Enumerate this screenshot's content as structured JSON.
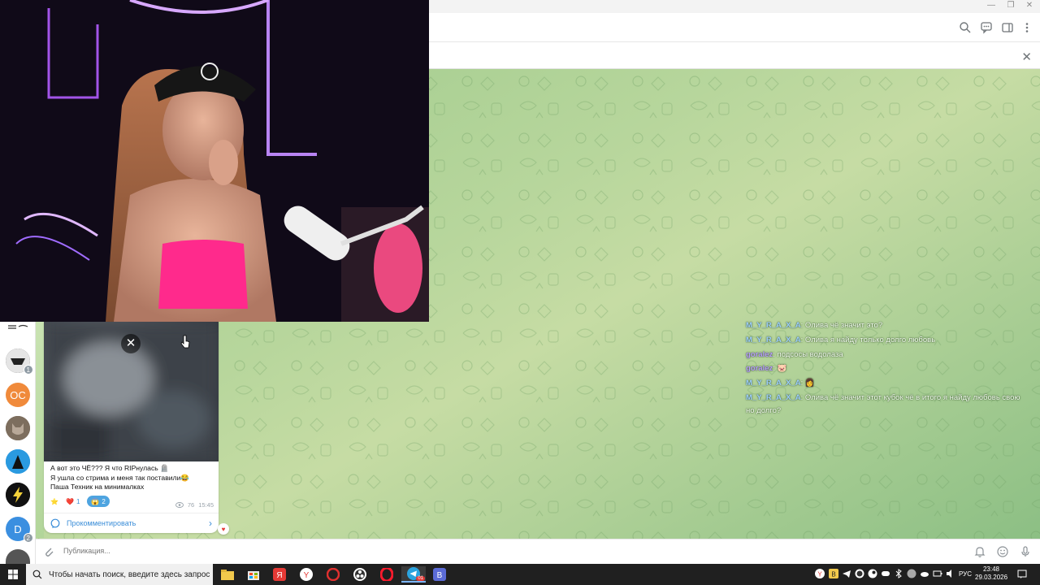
{
  "pinned": {
    "close_icon": "close-icon"
  },
  "overlay_chat": [
    {
      "user": "M_Y_R_A_X_A",
      "user_color": "#9fd0ff",
      "text": "Олива чё значит это?"
    },
    {
      "user": "M_Y_R_A_X_A",
      "user_color": "#9fd0ff",
      "text": "Олива я найду только долго любовь"
    },
    {
      "user": "goralez",
      "user_color": "#b99cff",
      "text": "подсосы водолаза"
    },
    {
      "user": "goralez",
      "user_color": "#b99cff",
      "text": "🐷"
    },
    {
      "user": "M_Y_R_A_X_A",
      "user_color": "#9fd0ff",
      "text": "👩"
    },
    {
      "user": "M_Y_R_A_X_A",
      "user_color": "#9fd0ff",
      "text": "Олива чё значит этот кубок чё в итого я найду любовь свою",
      "continuation": "но долго?"
    }
  ],
  "sidebar": {
    "items": [
      {
        "initials": "",
        "color": "#2b2b2b",
        "badge": "1"
      },
      {
        "initials": "OC",
        "color": "#f08a3b",
        "badge": ""
      },
      {
        "initials": "",
        "color": "#6a5a4a",
        "badge": ""
      },
      {
        "initials": "",
        "color": "#2f8fd8",
        "badge": ""
      },
      {
        "initials": "",
        "color": "#111111",
        "badge": ""
      },
      {
        "initials": "D",
        "color": "#3b8fe0",
        "badge": "2"
      },
      {
        "initials": "",
        "color": "#555555",
        "badge": ""
      }
    ]
  },
  "post": {
    "lines": [
      "А вот это ЧЁ??? Я что RIPнулась 🪦",
      "Я ушла со стрима и меня так поставили😂",
      "Паша Техник на минималках"
    ],
    "reactions": [
      {
        "emoji": "⭐",
        "count": ""
      },
      {
        "emoji": "❤️",
        "count": "1"
      },
      {
        "emoji": "😱",
        "count": "2"
      }
    ],
    "views": "76",
    "time": "15:45",
    "comment_label": "Прокомментировать"
  },
  "composer": {
    "placeholder": "Публикация..."
  },
  "taskbar": {
    "search_placeholder": "Чтобы начать поиск, введите здесь запрос",
    "time": "23:48",
    "date": "29.03.2026",
    "lang": "РУС",
    "telegram_badge": "01"
  },
  "colors": {
    "accent": "#3a8dd8",
    "chat_bg": "#b7d69c"
  }
}
